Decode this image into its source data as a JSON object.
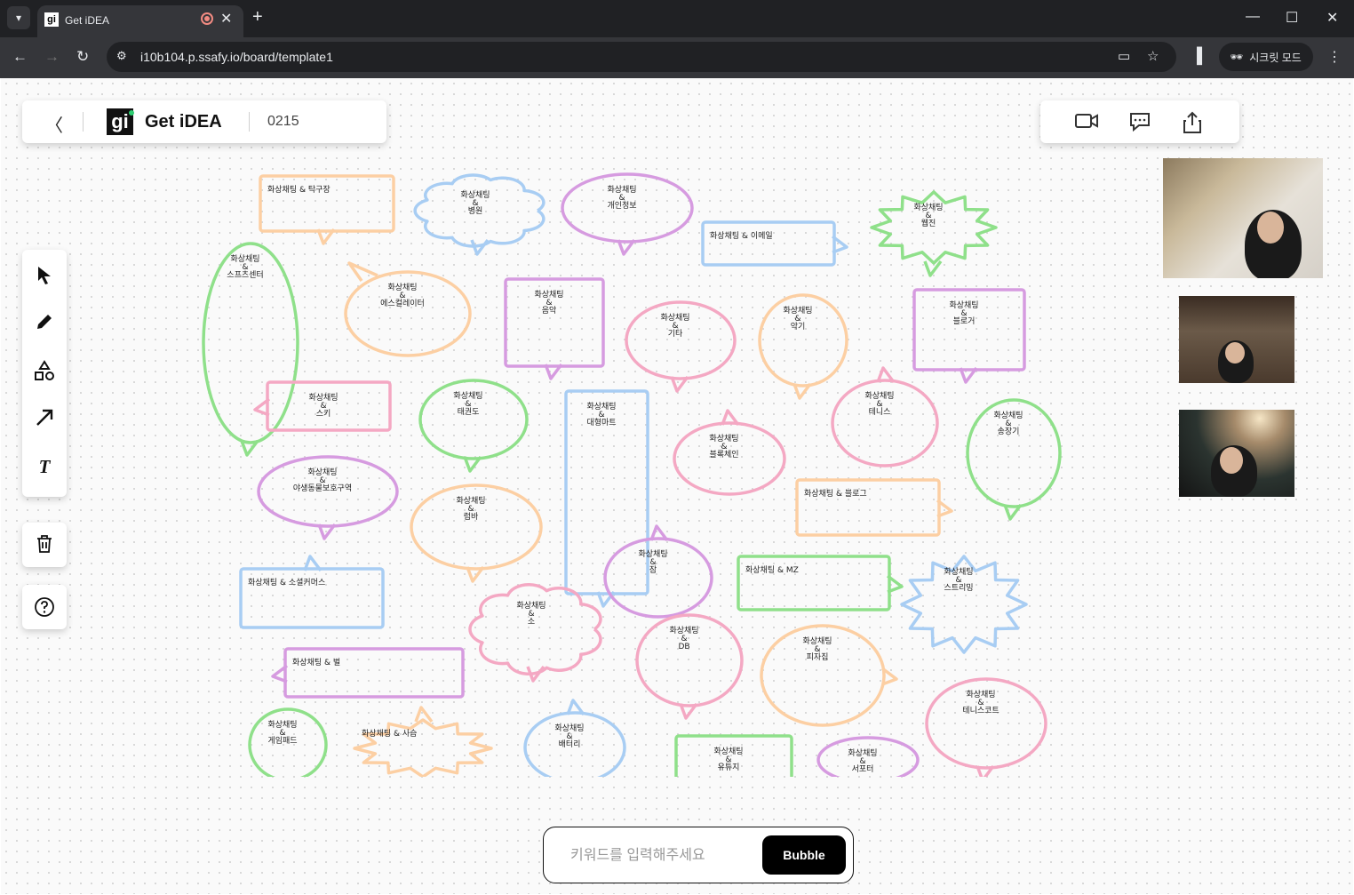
{
  "browser": {
    "tab_title": "Get iDEA",
    "favicon_text": "gi",
    "url": "i10b104.p.ssafy.io/board/template1",
    "incognito_label": "시크릿 모드"
  },
  "header": {
    "logo_text": "gi",
    "brand": "Get iDEA",
    "room_code": "0215"
  },
  "toolbar_icons": [
    "select-icon",
    "pen-icon",
    "shapes-icon",
    "arrow-icon",
    "text-icon"
  ],
  "input": {
    "placeholder": "키워드를 입력해주세요",
    "button_label": "Bubble"
  },
  "colors": {
    "orange": "#fccfa3",
    "blue": "#a8cdf3",
    "purple": "#d69be0",
    "green": "#8fe08a",
    "pink": "#f4a8c3"
  },
  "bubbles": [
    {
      "lines": [
        "화상채팅 & 탁구장"
      ],
      "shape": "rect",
      "color": "orange"
    },
    {
      "lines": [
        "화상채팅",
        "&",
        "병원"
      ],
      "shape": "cloud",
      "color": "blue"
    },
    {
      "lines": [
        "화상채팅",
        "&",
        "개인정보"
      ],
      "shape": "oval",
      "color": "purple"
    },
    {
      "lines": [
        "화상채팅 & 이메일"
      ],
      "shape": "rect",
      "color": "blue"
    },
    {
      "lines": [
        "화상채팅",
        "&",
        "웹진"
      ],
      "shape": "burst",
      "color": "green"
    },
    {
      "lines": [
        "화상채팅",
        "&",
        "스프츠센터"
      ],
      "shape": "oval",
      "color": "green"
    },
    {
      "lines": [
        "화상채팅",
        "&",
        "에스컬레이터"
      ],
      "shape": "oval",
      "color": "orange"
    },
    {
      "lines": [
        "화상채팅",
        "&",
        "음악"
      ],
      "shape": "rect",
      "color": "purple"
    },
    {
      "lines": [
        "화상채팅",
        "&",
        "기타"
      ],
      "shape": "oval",
      "color": "pink"
    },
    {
      "lines": [
        "화상채팅",
        "&",
        "악기"
      ],
      "shape": "oval",
      "color": "orange"
    },
    {
      "lines": [
        "화상채팅",
        "&",
        "블로거"
      ],
      "shape": "rect",
      "color": "purple"
    },
    {
      "lines": [
        "화상채팅",
        "&",
        "스키"
      ],
      "shape": "rect",
      "color": "pink"
    },
    {
      "lines": [
        "화상채팅",
        "&",
        "태권도"
      ],
      "shape": "oval",
      "color": "green"
    },
    {
      "lines": [
        "화상채팅",
        "&",
        "대형마트"
      ],
      "shape": "rect",
      "color": "blue"
    },
    {
      "lines": [
        "화상채팅",
        "&",
        "블록체인"
      ],
      "shape": "oval",
      "color": "pink"
    },
    {
      "lines": [
        "화상채팅",
        "&",
        "테니스"
      ],
      "shape": "oval",
      "color": "pink"
    },
    {
      "lines": [
        "화상채팅",
        "&",
        "송장기"
      ],
      "shape": "oval",
      "color": "green"
    },
    {
      "lines": [
        "화상채팅",
        "&",
        "야생동물보호구역"
      ],
      "shape": "oval",
      "color": "purple"
    },
    {
      "lines": [
        "화상채팅",
        "&",
        "럼바"
      ],
      "shape": "oval",
      "color": "orange"
    },
    {
      "lines": [
        "화상채팅 & 블로그"
      ],
      "shape": "rect",
      "color": "orange"
    },
    {
      "lines": [
        "화상채팅",
        "&",
        "잠"
      ],
      "shape": "oval",
      "color": "purple"
    },
    {
      "lines": [
        "화상채팅 & 소셜커머스"
      ],
      "shape": "rect",
      "color": "blue"
    },
    {
      "lines": [
        "화상채팅 & MZ"
      ],
      "shape": "rect",
      "color": "green"
    },
    {
      "lines": [
        "화상채팅",
        "&",
        "스트리밍"
      ],
      "shape": "burst",
      "color": "blue"
    },
    {
      "lines": [
        "화상채팅",
        "&",
        "소"
      ],
      "shape": "cloud",
      "color": "pink"
    },
    {
      "lines": [
        "화상채팅",
        "&",
        "DB"
      ],
      "shape": "oval",
      "color": "pink"
    },
    {
      "lines": [
        "화상채팅",
        "&",
        "피자집"
      ],
      "shape": "oval",
      "color": "orange"
    },
    {
      "lines": [
        "화상채팅 & 벌"
      ],
      "shape": "rect",
      "color": "purple"
    },
    {
      "lines": [
        "화상채팅",
        "&",
        "테니스코트"
      ],
      "shape": "oval",
      "color": "pink"
    },
    {
      "lines": [
        "화상채팅",
        "&",
        "게임패드"
      ],
      "shape": "oval",
      "color": "green"
    },
    {
      "lines": [
        "화상채팅 & 사슴"
      ],
      "shape": "burst",
      "color": "orange"
    },
    {
      "lines": [
        "화상채팅",
        "&",
        "배터리"
      ],
      "shape": "oval",
      "color": "blue"
    },
    {
      "lines": [
        "화상채팅",
        "&",
        "유튜지"
      ],
      "shape": "rect",
      "color": "green"
    },
    {
      "lines": [
        "화상채팅",
        "&",
        "서포터"
      ],
      "shape": "oval",
      "color": "purple"
    }
  ]
}
